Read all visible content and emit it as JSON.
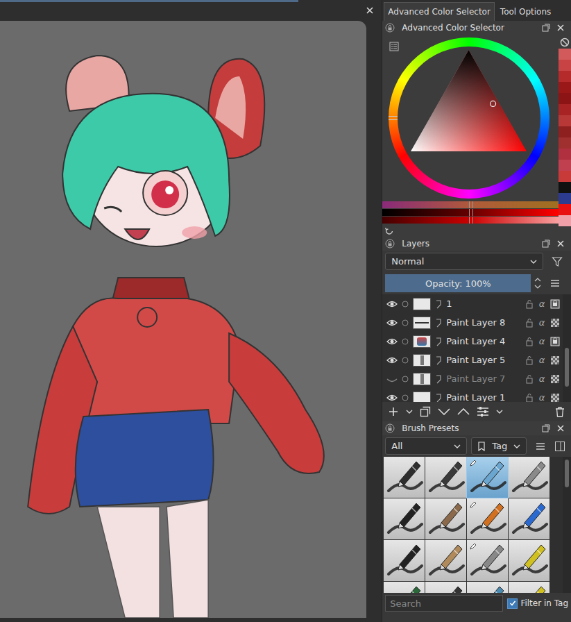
{
  "tabs": [
    {
      "label": "Advanced Color Selector",
      "selected": true
    },
    {
      "label": "Tool Options",
      "selected": false
    }
  ],
  "color_selector": {
    "title": "Advanced Color Selector",
    "hue_level": 0.75,
    "cursor_x_level": 0.71,
    "cursor_y_level": 0.53,
    "sliders": [
      {
        "level": 0.5
      },
      {
        "level": 0.5
      },
      {
        "level": 0.5
      }
    ],
    "history": [
      {
        "color": "#d25a5a"
      },
      {
        "color": "#c84444"
      },
      {
        "color": "#b52a2a"
      },
      {
        "color": "#9a1818"
      },
      {
        "color": "#8c1414"
      },
      {
        "color": "#a82424"
      },
      {
        "color": "#b83838"
      },
      {
        "color": "#8e2020"
      },
      {
        "color": "#a03030"
      },
      {
        "color": "#b03040"
      },
      {
        "color": "#c04050"
      },
      {
        "color": "#c83a3a"
      },
      {
        "color": "#111111"
      },
      {
        "color": "#2c3a8f"
      },
      {
        "color": "#e81010"
      },
      {
        "color": "#f0a0a8"
      }
    ]
  },
  "layers": {
    "title": "Layers",
    "blend_mode": "Normal",
    "opacity": {
      "label": "Opacity: 100%",
      "level": 1
    },
    "alpha_icon": "α",
    "items": [
      {
        "name": "1",
        "visible": true,
        "alpha_locked": true,
        "kind": "empty"
      },
      {
        "name": "Paint Layer 8",
        "visible": true,
        "alpha_locked": false,
        "kind": "line"
      },
      {
        "name": "Paint Layer 4",
        "visible": true,
        "alpha_locked": true,
        "kind": "figure"
      },
      {
        "name": "Paint Layer 5",
        "visible": true,
        "alpha_locked": false,
        "kind": "column"
      },
      {
        "name": "Paint Layer 7",
        "visible": false,
        "alpha_locked": false,
        "kind": "column"
      },
      {
        "name": "Paint Layer 1",
        "visible": true,
        "alpha_locked": false,
        "kind": "empty"
      }
    ]
  },
  "brush_presets": {
    "title": "Brush Presets",
    "filter": "All",
    "tag": "Tag",
    "presets": [
      {
        "selected": false,
        "edited": false,
        "color": "#2e2e2e"
      },
      {
        "selected": false,
        "edited": false,
        "color": "#3a3a3a"
      },
      {
        "selected": true,
        "edited": true,
        "color": "#6aa6d0"
      },
      {
        "selected": false,
        "edited": false,
        "color": "#8a8a8a"
      },
      {
        "selected": false,
        "edited": false,
        "color": "#222222"
      },
      {
        "selected": false,
        "edited": false,
        "color": "#8a6a4a"
      },
      {
        "selected": false,
        "edited": true,
        "color": "#d07020"
      },
      {
        "selected": false,
        "edited": false,
        "color": "#2a6ad0"
      },
      {
        "selected": false,
        "edited": false,
        "color": "#222222"
      },
      {
        "selected": false,
        "edited": false,
        "color": "#b08a5a"
      },
      {
        "selected": false,
        "edited": true,
        "color": "#888888"
      },
      {
        "selected": false,
        "edited": false,
        "color": "#d0c020"
      },
      {
        "selected": false,
        "edited": false,
        "color": "#2a6a3a"
      },
      {
        "selected": false,
        "edited": false,
        "color": "#333333"
      },
      {
        "selected": false,
        "edited": false,
        "color": "#4a8ab0"
      },
      {
        "selected": false,
        "edited": false,
        "color": "#d0c020"
      }
    ],
    "search": {
      "placeholder": "Search"
    },
    "filter_in_tag": {
      "label": "Filter in Tag",
      "checked": true
    }
  }
}
